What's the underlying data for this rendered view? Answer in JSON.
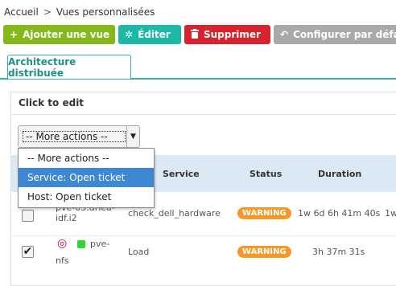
{
  "breadcrumb": {
    "home": "Accueil",
    "separator": ">",
    "current": "Vues personnalisées"
  },
  "toolbar": {
    "add_label": "Ajouter une vue",
    "edit_label": "Éditer",
    "delete_label": "Supprimer",
    "configure_label": "Configurer par défau"
  },
  "tab": {
    "label": "Architecture distribuée"
  },
  "panel": {
    "title": "Click to edit"
  },
  "actions_select": {
    "selected": "-- More actions --",
    "options": [
      "-- More actions --",
      "Service: Open ticket",
      "Host: Open ticket"
    ],
    "highlighted": "Service: Open ticket"
  },
  "table": {
    "headers": {
      "service": "Service",
      "status": "Status",
      "duration": "Duration"
    },
    "rows": [
      {
        "checked": false,
        "host_line1": "pve-03.driea-",
        "host_line2": "idf.i2",
        "service": "check_dell_hardware",
        "status": "WARNING",
        "duration": "1w 6d 6h 41m 40s",
        "extra": "1w"
      },
      {
        "checked": true,
        "host_line1": "pve-",
        "host_line2": "nfs",
        "service": "Load",
        "status": "WARNING",
        "duration": "3h 37m 31s",
        "host_icon": "debian-icon",
        "host_status_color": "#2ad92a"
      }
    ]
  },
  "colors": {
    "add": "#84b81b",
    "edit": "#1db8a6",
    "delete": "#d8232f",
    "configure": "#a9a9a9",
    "accent": "#35b0a8",
    "warning": "#f4982a",
    "highlight": "#3e87d3"
  }
}
